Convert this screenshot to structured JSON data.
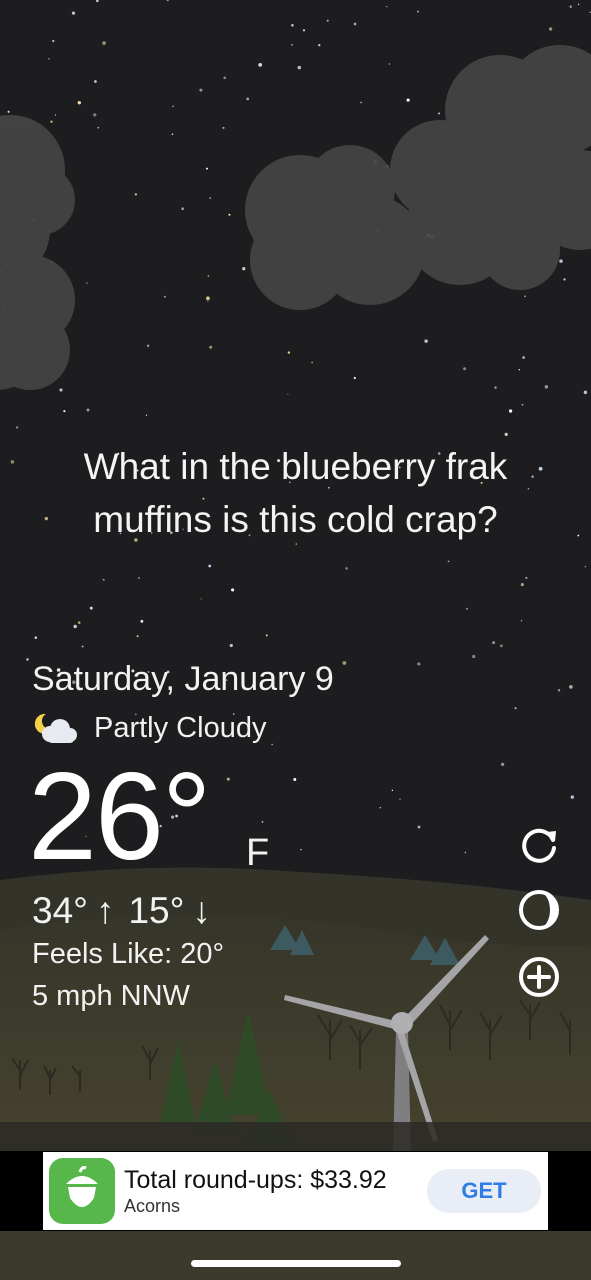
{
  "quote": {
    "line1": "What in the blueberry frak",
    "line2": "muffins is this cold crap?"
  },
  "date": "Saturday, January 9",
  "condition": {
    "text": "Partly Cloudy",
    "icon": "moon-cloud-icon"
  },
  "temperature": {
    "current": "26°",
    "unit": "F",
    "high": "34°",
    "low": "15°",
    "feels_like": "Feels Like: 20°",
    "wind": "5 mph NNW"
  },
  "side_actions": [
    {
      "name": "refresh",
      "icon": "refresh-icon"
    },
    {
      "name": "moon-phase",
      "icon": "moon-phase-icon"
    },
    {
      "name": "add",
      "icon": "plus-circle-icon"
    }
  ],
  "ad": {
    "title": "Total round-ups: $33.92",
    "subtitle": "Acorns",
    "cta": "GET",
    "brand_color": "#57b74b",
    "cta_color": "#2f7be8"
  },
  "colors": {
    "sky": "#1d1c1f",
    "ground": "#4d4a30",
    "text": "#ffffff"
  }
}
